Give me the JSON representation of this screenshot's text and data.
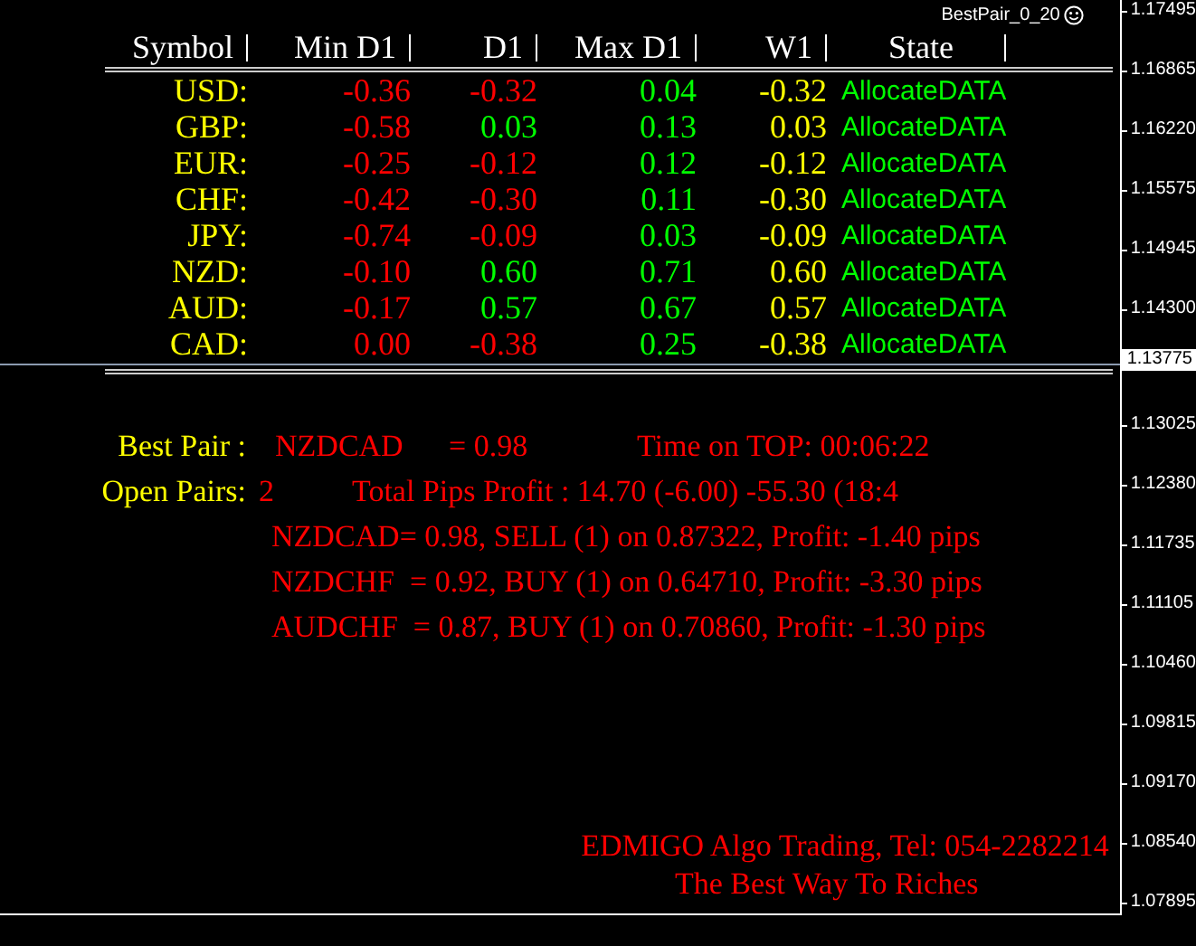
{
  "indicator_label": "BestPair_0_20",
  "table": {
    "columns": [
      "Symbol",
      "Min D1",
      "D1",
      "Max D1",
      "W1",
      "State"
    ],
    "rows": [
      {
        "symbol": "USD:",
        "min_d1": {
          "text": "-0.36",
          "color": "#ff0000"
        },
        "d1": {
          "text": "-0.32",
          "color": "#ff0000"
        },
        "max_d1": {
          "text": "0.04",
          "color": "#00ff00"
        },
        "w1": "-0.32",
        "state": "AllocateDATA"
      },
      {
        "symbol": "GBP:",
        "min_d1": {
          "text": "-0.58",
          "color": "#ff0000"
        },
        "d1": {
          "text": "0.03",
          "color": "#00ff00"
        },
        "max_d1": {
          "text": "0.13",
          "color": "#00ff00"
        },
        "w1": "0.03",
        "state": "AllocateDATA"
      },
      {
        "symbol": "EUR:",
        "min_d1": {
          "text": "-0.25",
          "color": "#ff0000"
        },
        "d1": {
          "text": "-0.12",
          "color": "#ff0000"
        },
        "max_d1": {
          "text": "0.12",
          "color": "#00ff00"
        },
        "w1": "-0.12",
        "state": "AllocateDATA"
      },
      {
        "symbol": "CHF:",
        "min_d1": {
          "text": "-0.42",
          "color": "#ff0000"
        },
        "d1": {
          "text": "-0.30",
          "color": "#ff0000"
        },
        "max_d1": {
          "text": "0.11",
          "color": "#00ff00"
        },
        "w1": "-0.30",
        "state": "AllocateDATA"
      },
      {
        "symbol": "JPY:",
        "min_d1": {
          "text": "-0.74",
          "color": "#ff0000"
        },
        "d1": {
          "text": "-0.09",
          "color": "#ff0000"
        },
        "max_d1": {
          "text": "0.03",
          "color": "#00ff00"
        },
        "w1": "-0.09",
        "state": "AllocateDATA"
      },
      {
        "symbol": "NZD:",
        "min_d1": {
          "text": "-0.10",
          "color": "#ff0000"
        },
        "d1": {
          "text": "0.60",
          "color": "#00ff00"
        },
        "max_d1": {
          "text": "0.71",
          "color": "#00ff00"
        },
        "w1": "0.60",
        "state": "AllocateDATA"
      },
      {
        "symbol": "AUD:",
        "min_d1": {
          "text": "-0.17",
          "color": "#ff0000"
        },
        "d1": {
          "text": "0.57",
          "color": "#00ff00"
        },
        "max_d1": {
          "text": "0.67",
          "color": "#00ff00"
        },
        "w1": "0.57",
        "state": "AllocateDATA"
      },
      {
        "symbol": "CAD:",
        "min_d1": {
          "text": "0.00",
          "color": "#ff0000"
        },
        "d1": {
          "text": "-0.38",
          "color": "#ff0000"
        },
        "max_d1": {
          "text": "0.25",
          "color": "#00ff00"
        },
        "w1": "-0.38",
        "state": "AllocateDATA"
      }
    ]
  },
  "best_pair": {
    "label": "Best Pair :",
    "pair": "NZDCAD",
    "value": "= 0.98",
    "time_on_top": "Time on TOP: 00:06:22"
  },
  "open_pairs": {
    "label": "Open Pairs:",
    "count": "2",
    "total": "Total Pips Profit : 14.70 (-6.00) -55.30 (18:4",
    "positions": [
      "NZDCAD= 0.98, SELL (1) on 0.87322, Profit: -1.40 pips",
      "NZDCHF  = 0.92, BUY (1) on 0.64710, Profit: -3.30 pips",
      "AUDCHF  = 0.87, BUY (1) on 0.70860, Profit: -1.30 pips"
    ]
  },
  "footer": {
    "company": "EDMIGO Algo Trading, Tel: 054-2282214",
    "slogan": "The Best Way To Riches"
  },
  "price_axis": {
    "upper_ticks": [
      "1.17495",
      "1.16865",
      "1.16220",
      "1.15575",
      "1.14945",
      "1.14300"
    ],
    "current_price": "1.13775",
    "lower_ticks": [
      "1.13025",
      "1.12380",
      "1.11735",
      "1.11105",
      "1.10460",
      "1.09815",
      "1.09170",
      "1.08540",
      "1.07895"
    ]
  }
}
